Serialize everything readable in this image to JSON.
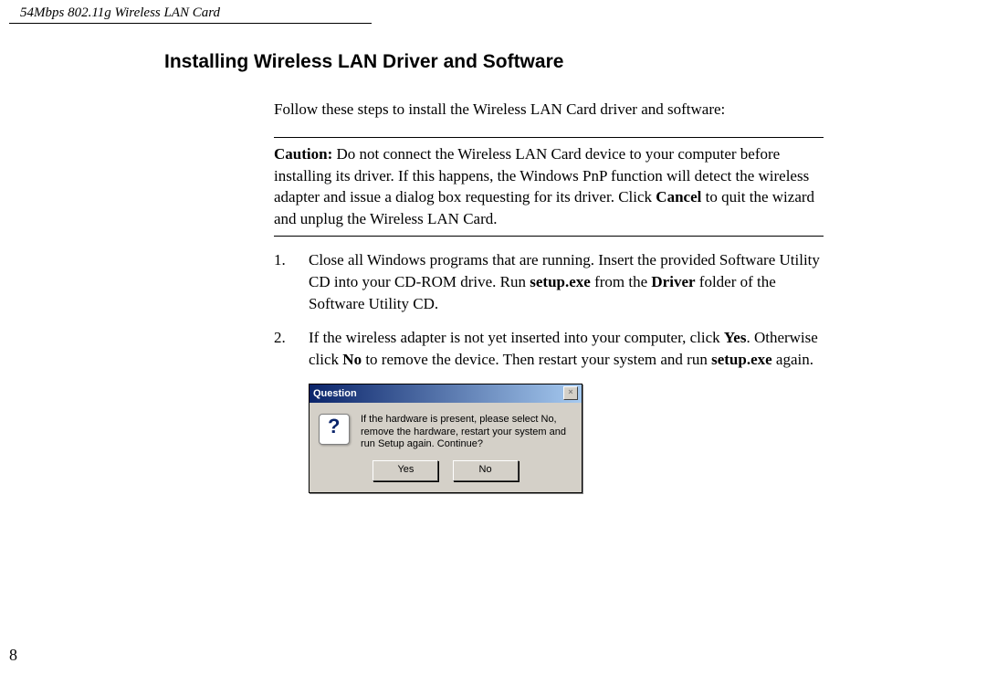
{
  "header": {
    "product": "54Mbps 802.11g Wireless LAN Card"
  },
  "section": {
    "title": "Installing Wireless LAN Driver and Software"
  },
  "intro": "Follow these steps to install the Wireless LAN Card driver and software:",
  "caution": {
    "label": "Caution:",
    "text_a": " Do not connect the Wireless LAN Card device to your computer before installing its driver. If this happens, the Windows PnP function will detect the wireless adapter and issue a dialog box requesting for its driver. Click ",
    "bold_a": "Cancel",
    "text_b": " to quit the wizard and unplug the Wireless LAN Card."
  },
  "steps": [
    {
      "num": "1.",
      "t1": "Close all Windows programs that are running. Insert the provided Software Utility CD into your CD-ROM drive. Run ",
      "b1": "setup.exe",
      "t2": " from the ",
      "b2": "Driver",
      "t3": " folder of the Software Utility CD."
    },
    {
      "num": "2.",
      "t1": "If the wireless adapter is not yet inserted into your computer, click ",
      "b1": "Yes",
      "t2": ". Otherwise click ",
      "b2": "No",
      "t3": " to remove the device. Then restart your system and run ",
      "b3": "setup.exe",
      "t4": " again."
    }
  ],
  "dialog": {
    "title": "Question",
    "close": "×",
    "message": "If the hardware is present, please select No, remove the hardware, restart your system and run Setup again. Continue?",
    "yes": "Yes",
    "no": "No"
  },
  "page_number": "8"
}
